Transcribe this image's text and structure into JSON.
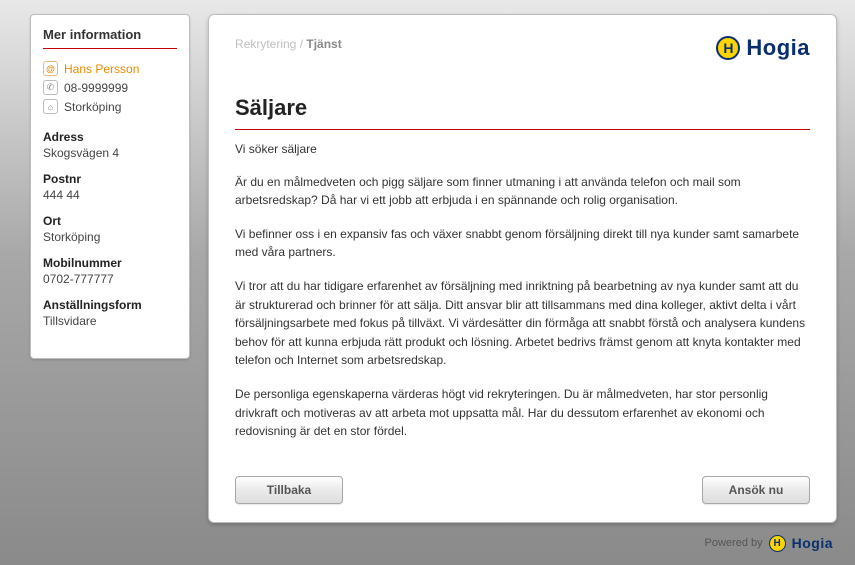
{
  "sidebar": {
    "title": "Mer information",
    "contact": {
      "name": "Hans Persson",
      "phone": "08-9999999",
      "location": "Storköping"
    },
    "fields": [
      {
        "label": "Adress",
        "value": "Skogsvägen 4"
      },
      {
        "label": "Postnr",
        "value": "444 44"
      },
      {
        "label": "Ort",
        "value": "Storköping"
      },
      {
        "label": "Mobilnummer",
        "value": "0702-777777"
      },
      {
        "label": "Anställningsform",
        "value": "Tillsvidare"
      }
    ]
  },
  "breadcrumb": {
    "root": "Rekrytering",
    "sep": " / ",
    "current": "Tjänst"
  },
  "brand": {
    "name": "Hogia",
    "initial": "H",
    "accent_yellow": "#ffd400",
    "accent_blue": "#0a2f6e"
  },
  "title": "Säljare",
  "body": {
    "lead": "Vi söker säljare",
    "p1": "Är du en målmedveten och pigg säljare som finner utmaning i att använda telefon och mail som arbetsredskap? Då har vi ett jobb att erbjuda i en spännande och rolig organisation.",
    "p2": "Vi befinner oss i en expansiv fas och växer snabbt genom försäljning direkt till nya kunder samt samarbete med våra partners.",
    "p3": "Vi tror att du har tidigare erfarenhet av försäljning med inriktning på bearbetning av nya kunder samt att du är strukturerad och brinner för att sälja. Ditt ansvar blir att tillsammans med dina kolleger, aktivt delta i vårt försäljningsarbete med fokus på tillväxt. Vi värdesätter din förmåga att snabbt förstå och analysera kundens behov för att kunna erbjuda rätt produkt och lösning. Arbetet bedrivs främst genom att knyta kontakter med telefon och Internet som arbetsredskap.",
    "p4": "De personliga egenskaperna värderas högt vid rekryteringen. Du är målmedveten, har stor personlig drivkraft och motiveras av att arbeta mot uppsatta mål. Har du dessutom erfarenhet av ekonomi och redovisning är det en stor fördel."
  },
  "buttons": {
    "back": "Tillbaka",
    "apply": "Ansök nu"
  },
  "powered": {
    "label": "Powered by"
  }
}
